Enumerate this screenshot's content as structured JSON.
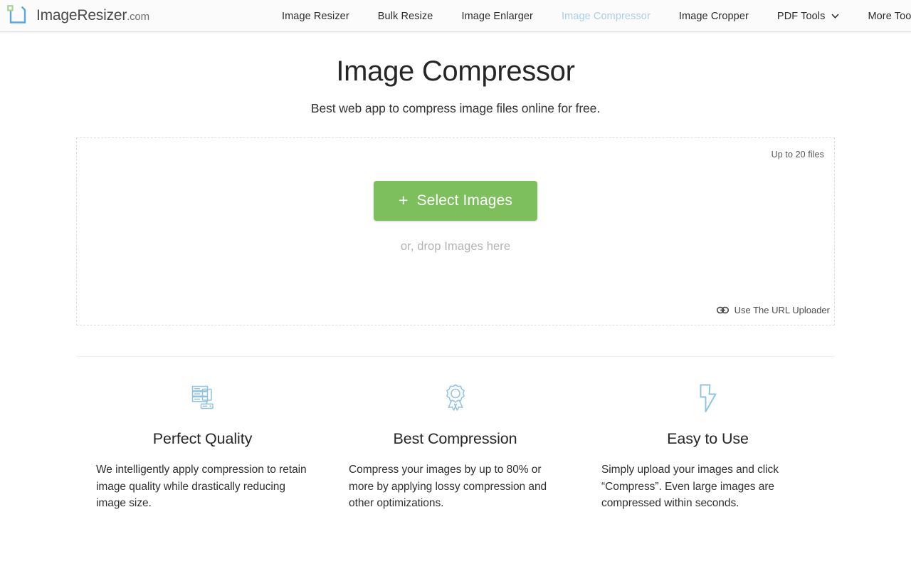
{
  "header": {
    "brand": {
      "name": "ImageResizer",
      "tld": ".com",
      "logo_icon": "square-outline-logo-icon",
      "logo_color": "#5aa9dd",
      "logo_accent_color": "#a8d08d"
    },
    "nav": [
      {
        "label": "Image Resizer",
        "active": false,
        "has_caret": false
      },
      {
        "label": "Bulk Resize",
        "active": false,
        "has_caret": false
      },
      {
        "label": "Image Enlarger",
        "active": false,
        "has_caret": false
      },
      {
        "label": "Image Compressor",
        "active": true,
        "has_caret": false
      },
      {
        "label": "Image Cropper",
        "active": false,
        "has_caret": false
      },
      {
        "label": "PDF Tools",
        "active": false,
        "has_caret": true
      },
      {
        "label": "More Tools",
        "active": false,
        "has_caret": true
      }
    ],
    "active_color": "#a9cfeb"
  },
  "main": {
    "title": "Image Compressor",
    "subtitle": "Best web app to compress image files online for free.",
    "dropzone": {
      "limit_note": "Up to 20 files",
      "select_button": "Select Images",
      "select_button_plus": "+",
      "select_button_color": "#7ebf5d",
      "drop_text": "or, drop Images here",
      "url_uploader_label": "Use The URL Uploader",
      "url_uploader_icon": "link-icon"
    }
  },
  "features": [
    {
      "icon": "server-stack-icon",
      "title": "Perfect Quality",
      "description": "We intelligently apply compression to retain image quality while drastically reducing image size."
    },
    {
      "icon": "award-ribbon-icon",
      "title": "Best Compression",
      "description": "Compress your images by up to 80% or more by applying lossy compression and other optimizations."
    },
    {
      "icon": "lightning-bolt-icon",
      "title": "Easy to Use",
      "description": "Simply upload your images and click “Compress”. Even large images are compressed within seconds."
    }
  ],
  "theme": {
    "icon_color": "#8fc3e3",
    "page_background": "#ffffff",
    "header_background": "#fbfbfb"
  }
}
